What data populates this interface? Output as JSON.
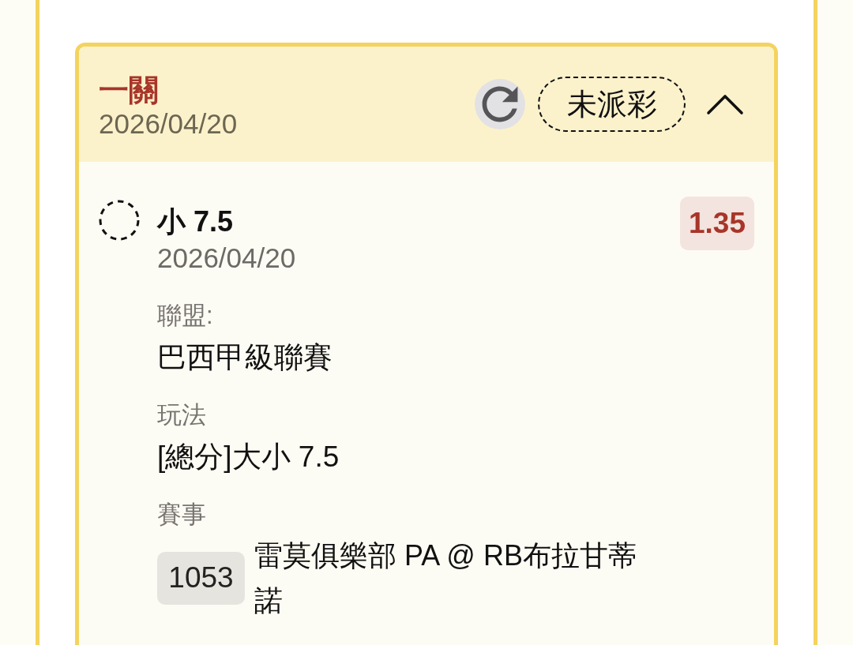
{
  "bet": {
    "title": "一關",
    "date": "2026/04/20",
    "status": "未派彩",
    "expanded": true,
    "selections": [
      {
        "settled": false,
        "pick": "小 7.5",
        "date": "2026/04/20",
        "odds": "1.35",
        "fields": [
          {
            "kind": "text",
            "label": "聯盟:",
            "value": "巴西甲級聯賽"
          },
          {
            "kind": "text",
            "label": "玩法",
            "value": "[總分]大小 7.5"
          },
          {
            "kind": "match",
            "label": "賽事",
            "match_number": "1053",
            "value": "雷莫俱樂部 PA @ RB布拉甘蒂諾"
          }
        ]
      }
    ]
  }
}
